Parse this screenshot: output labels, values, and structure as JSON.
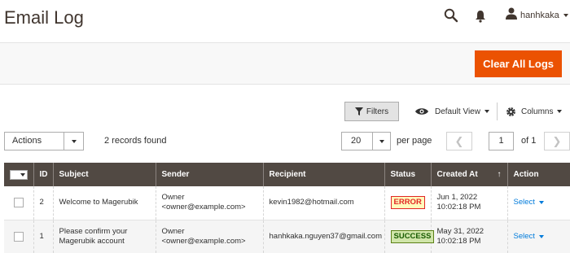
{
  "header": {
    "title": "Email Log",
    "user_name": "hanhkaka"
  },
  "action_bar": {
    "clear_button": "Clear All Logs"
  },
  "grid_controls": {
    "filters_label": "Filters",
    "view_label": "Default View",
    "columns_label": "Columns",
    "actions_label": "Actions",
    "records_found": "2 records found",
    "per_page_value": "20",
    "per_page_label": "per page",
    "current_page": "1",
    "of_pages": "of 1"
  },
  "table": {
    "columns": [
      "ID",
      "Subject",
      "Sender",
      "Recipient",
      "Status",
      "Created At",
      "Action"
    ],
    "sort_indicator": "↑",
    "rows": [
      {
        "id": "2",
        "subject": "Welcome to Magerubik",
        "sender_name": "Owner",
        "sender_email": "<owner@example.com>",
        "recipient": "kevin1982@hotmail.com",
        "status": "ERROR",
        "created_date": "Jun 1, 2022",
        "created_time": "10:02:18 PM",
        "action": "Select"
      },
      {
        "id": "1",
        "subject_line1": "Please confirm your",
        "subject_line2": "Magerubik account",
        "sender_name": "Owner",
        "sender_email": "<owner@example.com>",
        "recipient": "hanhkaka.nguyen37@gmail.com",
        "status": "SUCCESS",
        "created_date": "May 31, 2022",
        "created_time": "10:02:18 PM",
        "action": "Select"
      }
    ]
  },
  "icons": {
    "search": "search-icon",
    "bell": "bell-icon",
    "user": "user-icon",
    "filter": "filter-icon",
    "eye": "eye-icon",
    "gear": "gear-icon"
  },
  "colors": {
    "accent": "#eb5202",
    "table_header": "#514943",
    "link": "#007bdb",
    "error": "#e22626",
    "success": "#185b00"
  }
}
